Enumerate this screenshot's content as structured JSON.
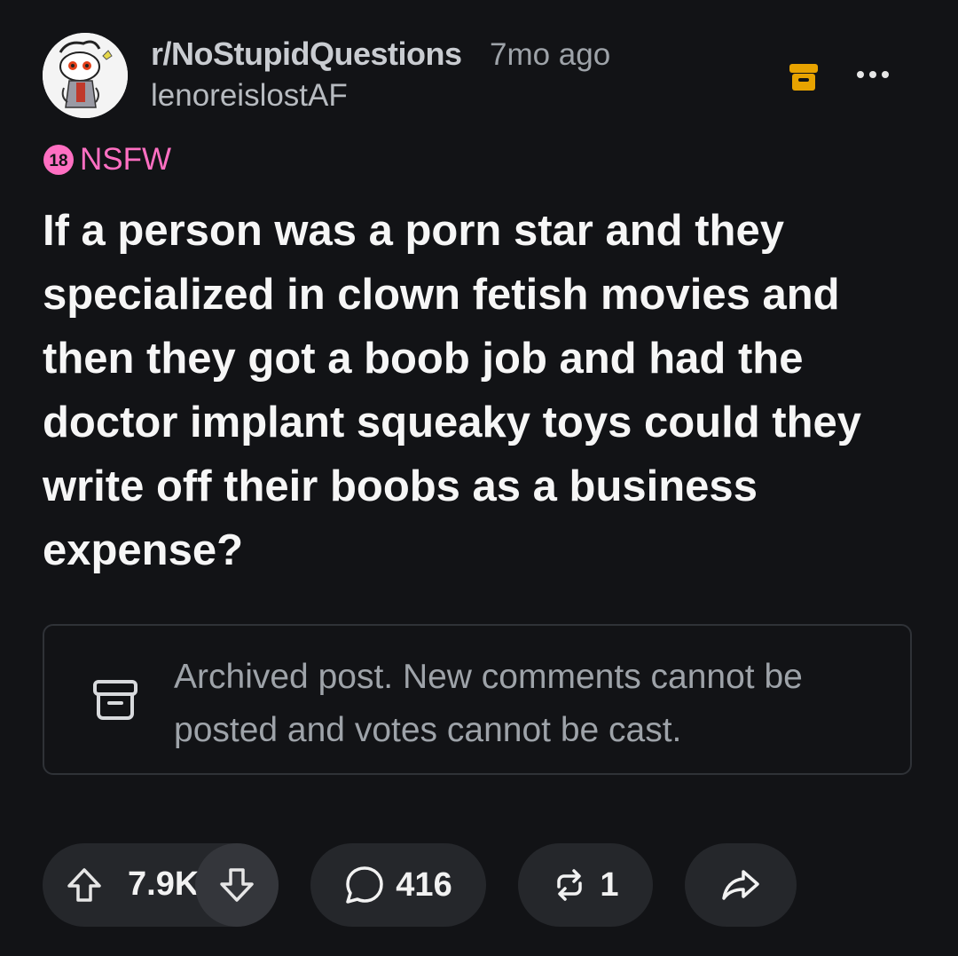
{
  "post": {
    "subreddit": "r/NoStupidQuestions",
    "time_ago": "7mo ago",
    "username": "lenoreislostAF",
    "nsfw_badge": {
      "number": "18",
      "label": "NSFW"
    },
    "title": "If a person was a porn star and they specialized in clown fetish movies and then they got a boob job and had the doctor implant squeaky toys could they write off their boobs as a business expense?",
    "archived_notice": "Archived post. New comments cannot be posted and votes cannot be cast."
  },
  "actions": {
    "vote_count": "7.9K",
    "comment_count": "416",
    "crosspost_count": "1"
  },
  "icons": {
    "archive": "archive-box-icon",
    "more": "more-options-icon",
    "upvote": "arrow-up-icon",
    "downvote": "arrow-down-icon",
    "comment": "speech-bubble-icon",
    "crosspost": "repost-icon",
    "share": "share-arrow-icon"
  },
  "colors": {
    "background": "#121316",
    "pill": "#25272b",
    "nsfw": "#ff6fc2",
    "archive_accent": "#e8a300",
    "muted_text": "#9ea3a9"
  }
}
